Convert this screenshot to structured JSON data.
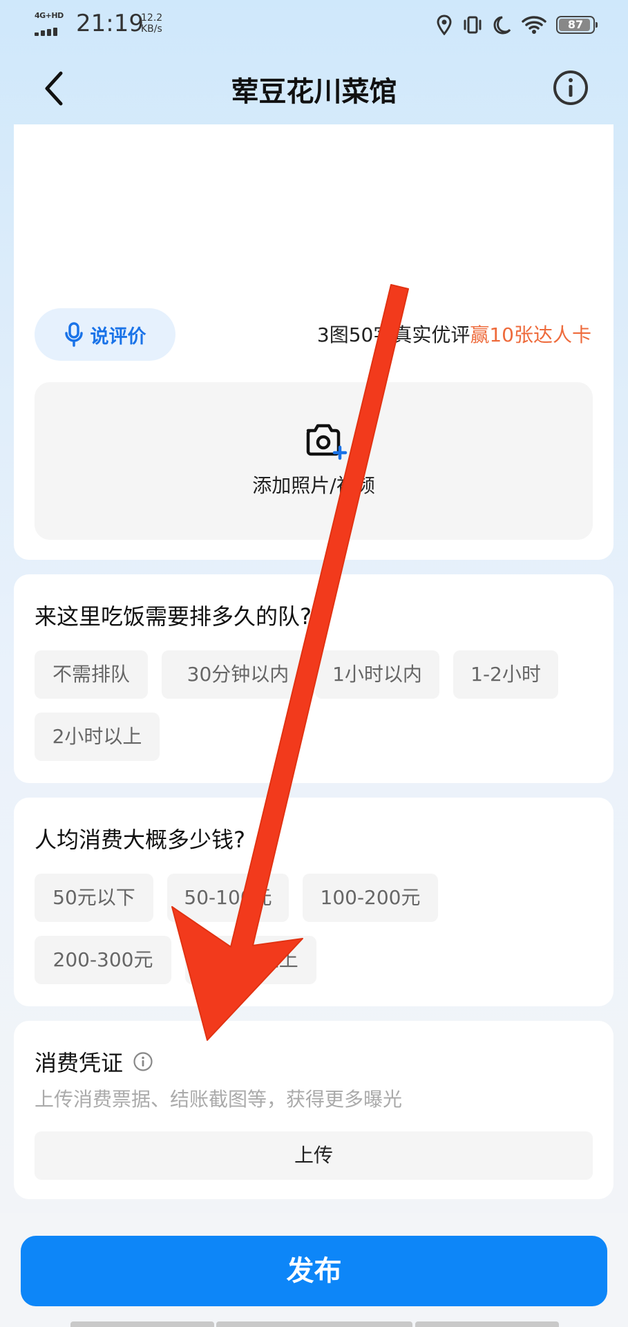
{
  "status_bar": {
    "network": "4G+HD",
    "time": "21:19",
    "speed_value": "12.2",
    "speed_unit": "KB/s",
    "battery_level": "87",
    "icons": [
      "location-icon",
      "vibrate-icon",
      "moon-icon",
      "wifi-icon",
      "battery-icon"
    ]
  },
  "nav": {
    "title": "荤豆花川菜馆",
    "back_icon": "chevron-left-icon",
    "info_icon": "info-circle-icon"
  },
  "review": {
    "voice_button_label": "说评价",
    "promo_text": "3图50字真实优评",
    "promo_highlight": "赢10张达人卡",
    "upload_label": "添加照片/视频"
  },
  "queue": {
    "question": "来这里吃饭需要排多久的队?",
    "options": [
      "不需排队",
      "30分钟以内",
      "1小时以内",
      "1-2小时",
      "2小时以上"
    ]
  },
  "price": {
    "question": "人均消费大概多少钱?",
    "options": [
      "50元以下",
      "50-100元",
      "100-200元",
      "200-300元",
      "300元以上"
    ]
  },
  "receipt": {
    "title": "消费凭证",
    "subtitle": "上传消费票据、结账截图等，获得更多曝光",
    "upload_label": "上传"
  },
  "footer": {
    "publish_label": "发布"
  },
  "colors": {
    "accent_blue": "#0d86f8",
    "promo_orange": "#ee6b3c",
    "overlay_arrow_red": "#f23a1c"
  }
}
